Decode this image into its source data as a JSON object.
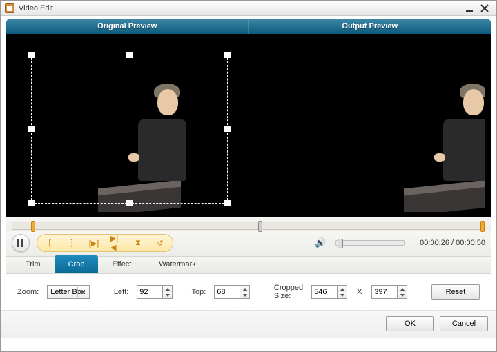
{
  "window": {
    "title": "Video Edit"
  },
  "header": {
    "original": "Original Preview",
    "output": "Output Preview"
  },
  "transport": {
    "time_current": "00:00:26",
    "time_total": "00:00:50"
  },
  "tabs": {
    "trim": "Trim",
    "crop": "Crop",
    "effect": "Effect",
    "watermark": "Watermark",
    "active": "crop"
  },
  "crop": {
    "zoom_label": "Zoom:",
    "zoom_value": "Letter Box",
    "left_label": "Left:",
    "left_value": "92",
    "top_label": "Top:",
    "top_value": "68",
    "cropped_label": "Cropped Size:",
    "width_value": "546",
    "x_label": "X",
    "height_value": "397",
    "reset_label": "Reset"
  },
  "footer": {
    "ok": "OK",
    "cancel": "Cancel"
  },
  "icons": {
    "bracket_in": "[",
    "bracket_out": "]",
    "play_range": "[▶]",
    "prev_next": "▶|◀",
    "sand": "⧗",
    "swap": "↺"
  }
}
